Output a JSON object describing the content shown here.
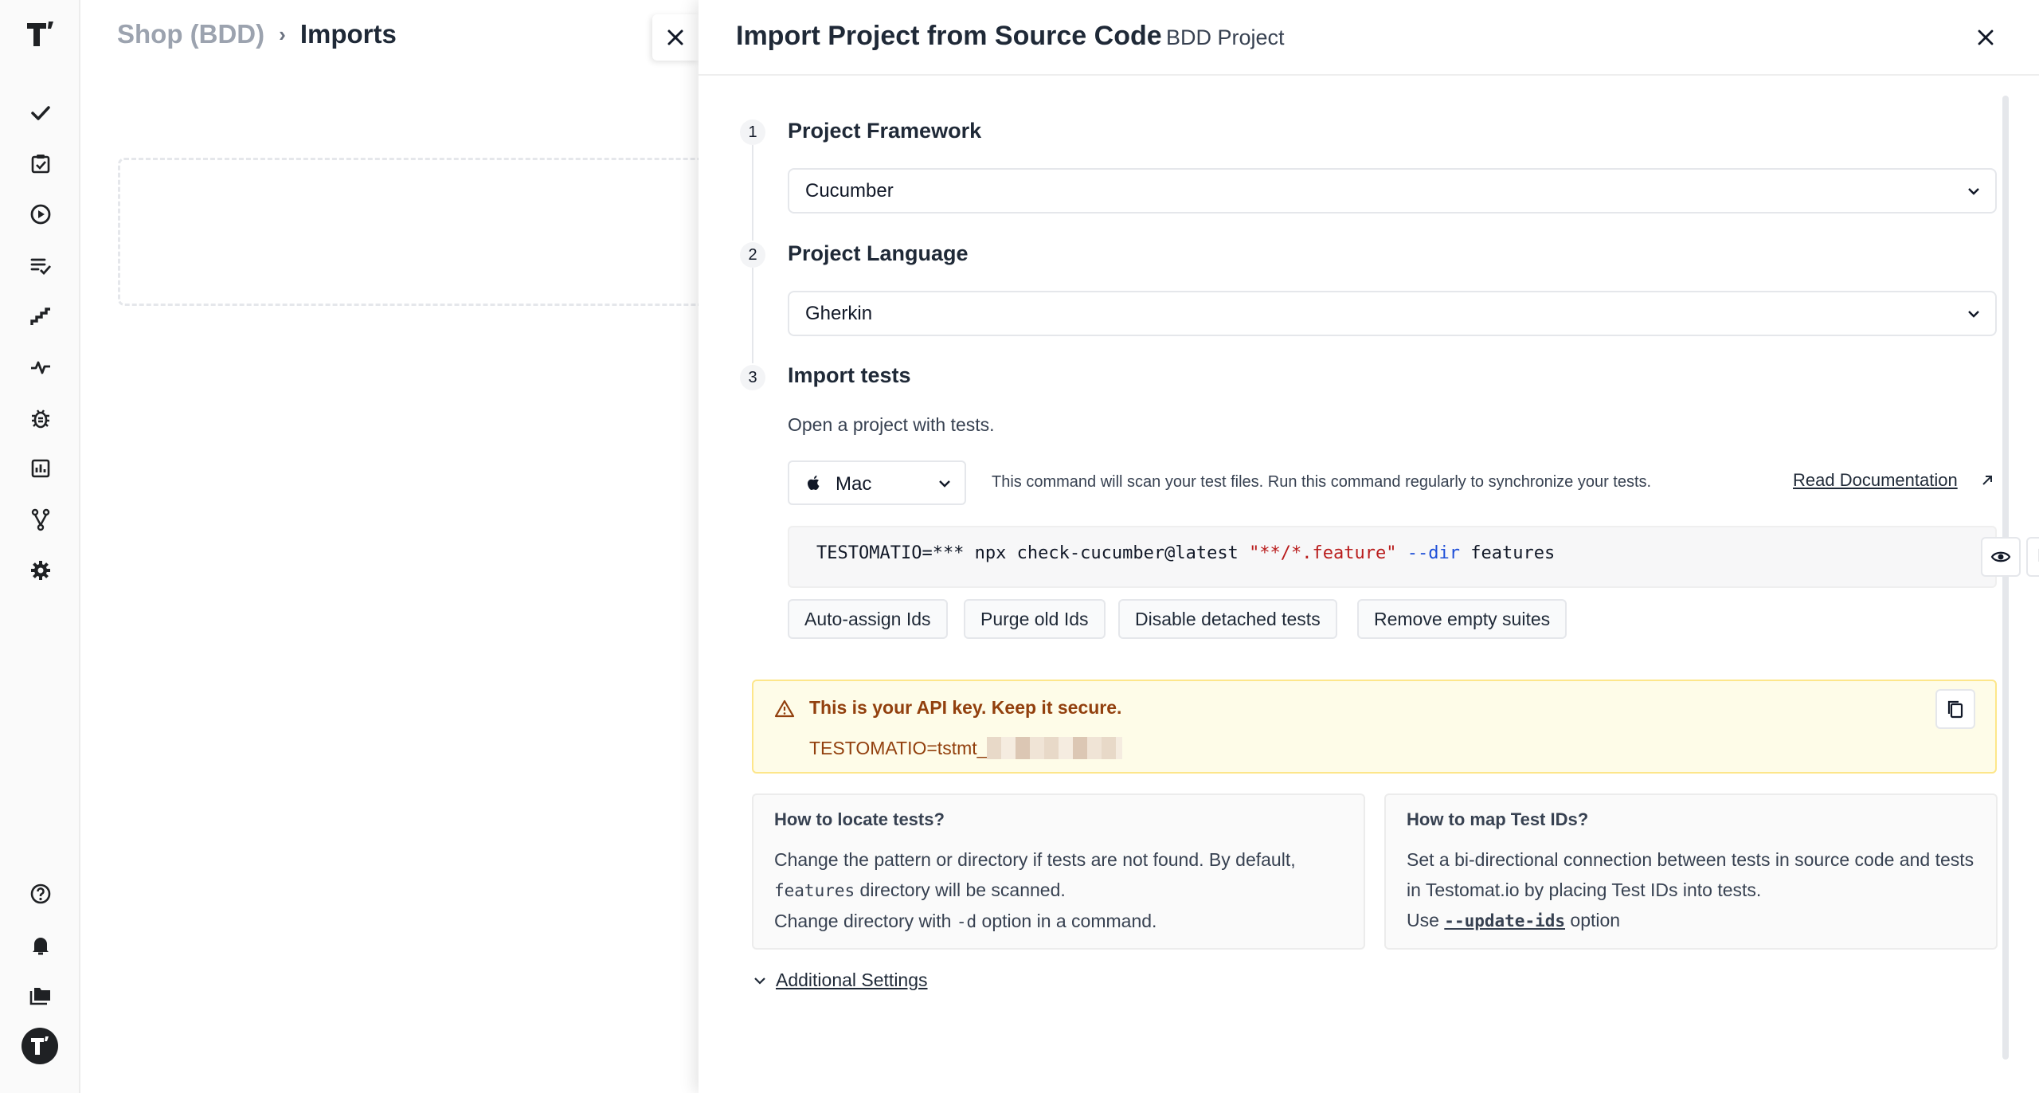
{
  "rail": {
    "logo_icon": "testomat-logo-icon",
    "items": [
      {
        "icon": "checkmark-icon"
      },
      {
        "icon": "clipboard-check-icon"
      },
      {
        "icon": "play-circle-icon"
      },
      {
        "icon": "list-check-icon"
      },
      {
        "icon": "steps-icon"
      },
      {
        "icon": "pulse-icon"
      },
      {
        "icon": "bug-icon"
      },
      {
        "icon": "bar-chart-icon"
      },
      {
        "icon": "branch-icon"
      },
      {
        "icon": "gear-icon"
      }
    ],
    "bottom_items": [
      {
        "icon": "help-icon"
      },
      {
        "icon": "bell-icon"
      },
      {
        "icon": "folders-icon"
      }
    ],
    "avatar_letter": "T"
  },
  "breadcrumb": {
    "root": "Shop (BDD)",
    "separator": "›",
    "current": "Imports"
  },
  "drawer": {
    "title": "Import Project from Source Code",
    "subtitle": "BDD Project",
    "steps": [
      {
        "number": "1",
        "title": "Project Framework",
        "selected": "Cucumber"
      },
      {
        "number": "2",
        "title": "Project Language",
        "selected": "Gherkin"
      },
      {
        "number": "3",
        "title": "Import tests"
      }
    ],
    "import": {
      "open_text": "Open a project with tests.",
      "os_selected": "Mac",
      "command_description": "This command will scan your test files. Run this command regularly to synchronize your tests.",
      "read_documentation": "Read Documentation",
      "command": {
        "prefix": "TESTOMATIO=*** npx check-cucumber@latest ",
        "pattern": "\"**/*.feature\"",
        "flag": "--dir",
        "arg": " features"
      },
      "option_buttons": [
        "Auto-assign Ids",
        "Purge old Ids",
        "Disable detached tests",
        "Remove empty suites"
      ]
    },
    "api_key": {
      "title": "This is your API key. Keep it secure.",
      "value_prefix": "TESTOMATIO=tstmt_"
    },
    "locate": {
      "title": "How to locate tests?",
      "line1": "Change the pattern or directory if tests are not found. By default,",
      "dir_code": "features",
      "line2": " directory will be scanned.",
      "line3_a": "Change directory with ",
      "option_code": "-d",
      "line3_b": " option in a command."
    },
    "map_ids": {
      "title": "How to map Test IDs?",
      "line1": "Set a bi-directional connection between tests in source code and tests in Testomat.io by placing Test IDs into tests.",
      "use_label": "Use ",
      "flag_code": "--update-ids",
      "option_label": " option"
    },
    "additional_settings": "Additional Settings"
  },
  "colors": {
    "api_text": "#92400e",
    "api_bg": "#fefce8",
    "code_string": "#b91c1c",
    "code_flag": "#1d4ed8"
  }
}
